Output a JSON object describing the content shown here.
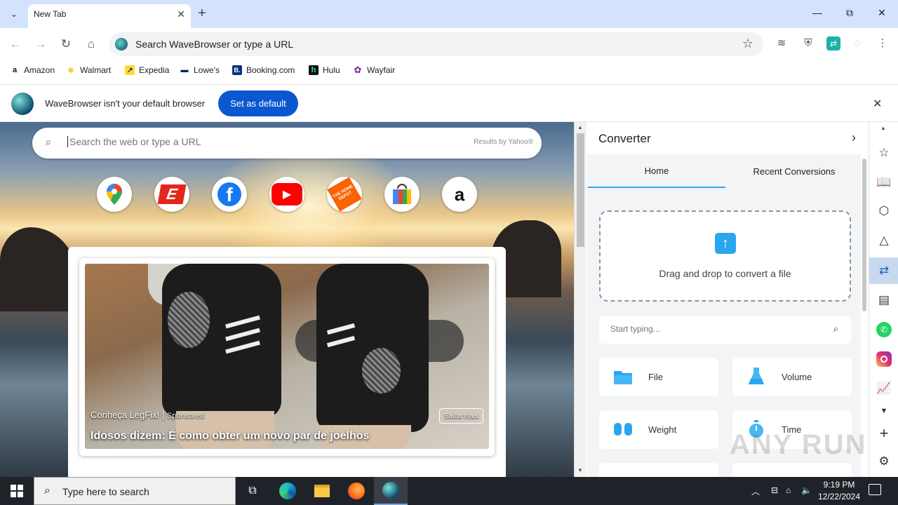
{
  "tab": {
    "title": "New Tab",
    "close": "✕",
    "new": "+"
  },
  "window": {
    "minimize": "—",
    "maximize": "⧉",
    "close": "✕"
  },
  "omnibox": {
    "placeholder": "Search WaveBrowser or type a URL"
  },
  "bookmarks": [
    {
      "label": "Amazon",
      "icon": "a",
      "color": "#111111"
    },
    {
      "label": "Walmart",
      "icon": "✱",
      "color": "#ffc220"
    },
    {
      "label": "Expedia",
      "icon": "↗",
      "color": "#fddb32"
    },
    {
      "label": "Lowe's",
      "icon": "▬",
      "color": "#012169"
    },
    {
      "label": "Booking.com",
      "icon": "B.",
      "color": "#003580"
    },
    {
      "label": "Hulu",
      "icon": "h",
      "color": "#1ce783"
    },
    {
      "label": "Wayfair",
      "icon": "✿",
      "color": "#7b189f"
    }
  ],
  "infobar": {
    "message": "WaveBrowser isn't your default browser",
    "button": "Set as default"
  },
  "newtab": {
    "search_placeholder": "Search the web or type a URL",
    "results_by": "Results by Yahoo®"
  },
  "shortcuts": [
    {
      "name": "google-maps",
      "glyph": "📍"
    },
    {
      "name": "espn",
      "glyph": "E"
    },
    {
      "name": "facebook",
      "glyph": "f"
    },
    {
      "name": "youtube",
      "glyph": "▶"
    },
    {
      "name": "home-depot",
      "glyph": "THE HOME DEPOT"
    },
    {
      "name": "shopping",
      "glyph": "🛍"
    },
    {
      "name": "amazon",
      "glyph": "a"
    }
  ],
  "ad": {
    "brand": "Conheça LegFix!",
    "sponsored": "Sponsored",
    "headline": "Idosos dizem: É como obter um novo par de joelhos",
    "cta": "Saiba mais"
  },
  "converter": {
    "title": "Converter",
    "tabs": [
      "Home",
      "Recent Conversions"
    ],
    "active_tab": "Home",
    "dropzone": "Drag and drop to convert a file",
    "search_placeholder": "Start typing...",
    "categories": [
      {
        "label": "File",
        "icon": "folder-icon",
        "color": "#2aa6ee"
      },
      {
        "label": "Volume",
        "icon": "flask-icon",
        "color": "#2aa6ee"
      },
      {
        "label": "Weight",
        "icon": "dumbbell-icon",
        "color": "#2aa6ee"
      },
      {
        "label": "Time",
        "icon": "stopwatch-icon",
        "color": "#2aa6ee"
      }
    ]
  },
  "taskbar": {
    "search_placeholder": "Type here to search",
    "time": "9:19 PM",
    "date": "12/22/2024"
  },
  "watermark": "ANY RUN"
}
